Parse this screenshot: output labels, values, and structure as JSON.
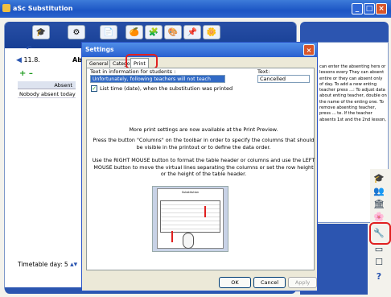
{
  "window": {
    "title": "aSc Substitution",
    "min": "_",
    "max": "□",
    "close": "×"
  },
  "toolbar": {
    "icons": [
      "🎓",
      "⚙",
      "📄",
      "🍊",
      "🧩",
      "🎨",
      "📌",
      "🌼"
    ]
  },
  "left": {
    "undo": "↶",
    "date_arrow": "◀",
    "date": "11.8.",
    "ab_label": "Ab",
    "plus_minus": "+ –",
    "absent_header": "Absent",
    "absent_row": "Nobody absent today",
    "timetable_day_label": "Timetable day: 5",
    "spinner": "▴▾"
  },
  "help": {
    "text": "can enter the absenting hers or lessons every They can absent entire or they can absent only of day. To add a new enting teacher press ...: To adjust data about enting teacher, double on the name of the enting one. To remove absenting teacher, press ... te. If the teacher absents 1st and the 2nd lesson,"
  },
  "right_icons": [
    "🎓",
    "👥",
    "🏛",
    "🌸",
    "🔧",
    "▭",
    "☐",
    "?"
  ],
  "dialog": {
    "title": "Settings",
    "close": "×",
    "tabs": [
      "General",
      "Catego",
      "Print"
    ],
    "text_info_label": "Text in information for students :",
    "text_info_value": "Unfortunately, following teachers will not teach today",
    "text_label": "Text:",
    "text_value": "Cancelled",
    "list_time_label": "List time (date), when the substitution was printed",
    "list_time_checked": "✓",
    "info1": "More print settings are now available at the Print Preview.",
    "info2": "Press the button \"Columns\" on the toolbar in order to specify the columns that should be visible in the printout or to define the data order.",
    "info3": "Use the RIGHT MOUSE button to format the table header or columns and use the LEFT MOUSE button to move the virtual lines separating the columns or set the row height or the height of the table header.",
    "preview_title": "Substitution",
    "ok": "OK",
    "cancel": "Cancel",
    "apply": "Apply"
  }
}
